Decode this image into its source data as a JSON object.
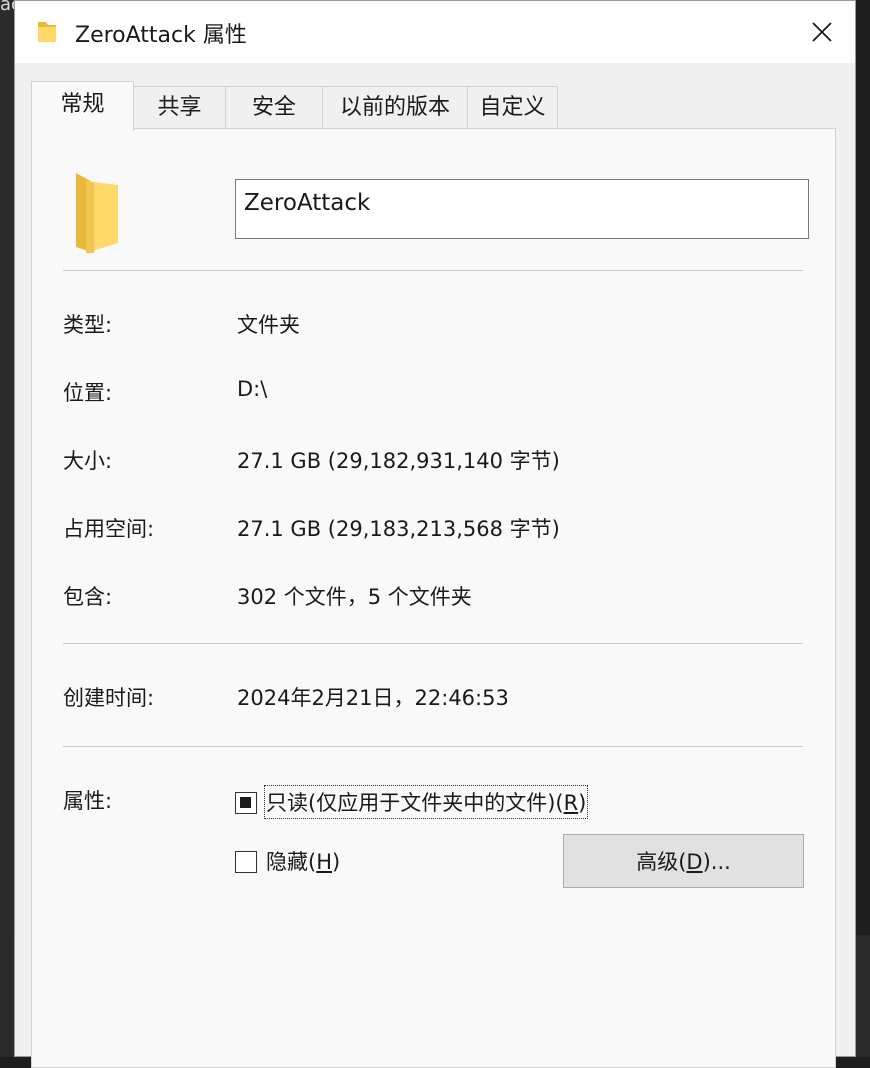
{
  "background": {
    "edge_text": "ac"
  },
  "window": {
    "title": "ZeroAttack 属性",
    "close_glyph": "✕"
  },
  "tabs": [
    {
      "label": "常规",
      "active": true
    },
    {
      "label": "共享",
      "active": false
    },
    {
      "label": "安全",
      "active": false
    },
    {
      "label": "以前的版本",
      "active": false
    },
    {
      "label": "自定义",
      "active": false
    }
  ],
  "general": {
    "folder_name": "ZeroAttack",
    "type_label": "类型:",
    "type_value": "文件夹",
    "location_label": "位置:",
    "location_value": "D:\\",
    "size_label": "大小:",
    "size_value": "27.1 GB (29,182,931,140 字节)",
    "size_on_disk_label": "占用空间:",
    "size_on_disk_value": "27.1 GB (29,183,213,568 字节)",
    "contains_label": "包含:",
    "contains_value": "302 个文件，5 个文件夹",
    "created_label": "创建时间:",
    "created_value": "2024年2月21日，22:46:53",
    "attributes_label": "属性:",
    "readonly_text": "只读(仅应用于文件夹中的文件)(",
    "readonly_key": "R",
    "readonly_close": ")",
    "readonly_state": "indeterminate",
    "hidden_text": "隐藏(",
    "hidden_key": "H",
    "hidden_close": ")",
    "hidden_checked": false,
    "advanced_text": "高级(",
    "advanced_key": "D",
    "advanced_close": ")..."
  },
  "colors": {
    "folder_light": "#ffd868",
    "folder_dark": "#e9b93c",
    "panel": "#f9f9f9",
    "window": "#f0f0f0"
  }
}
